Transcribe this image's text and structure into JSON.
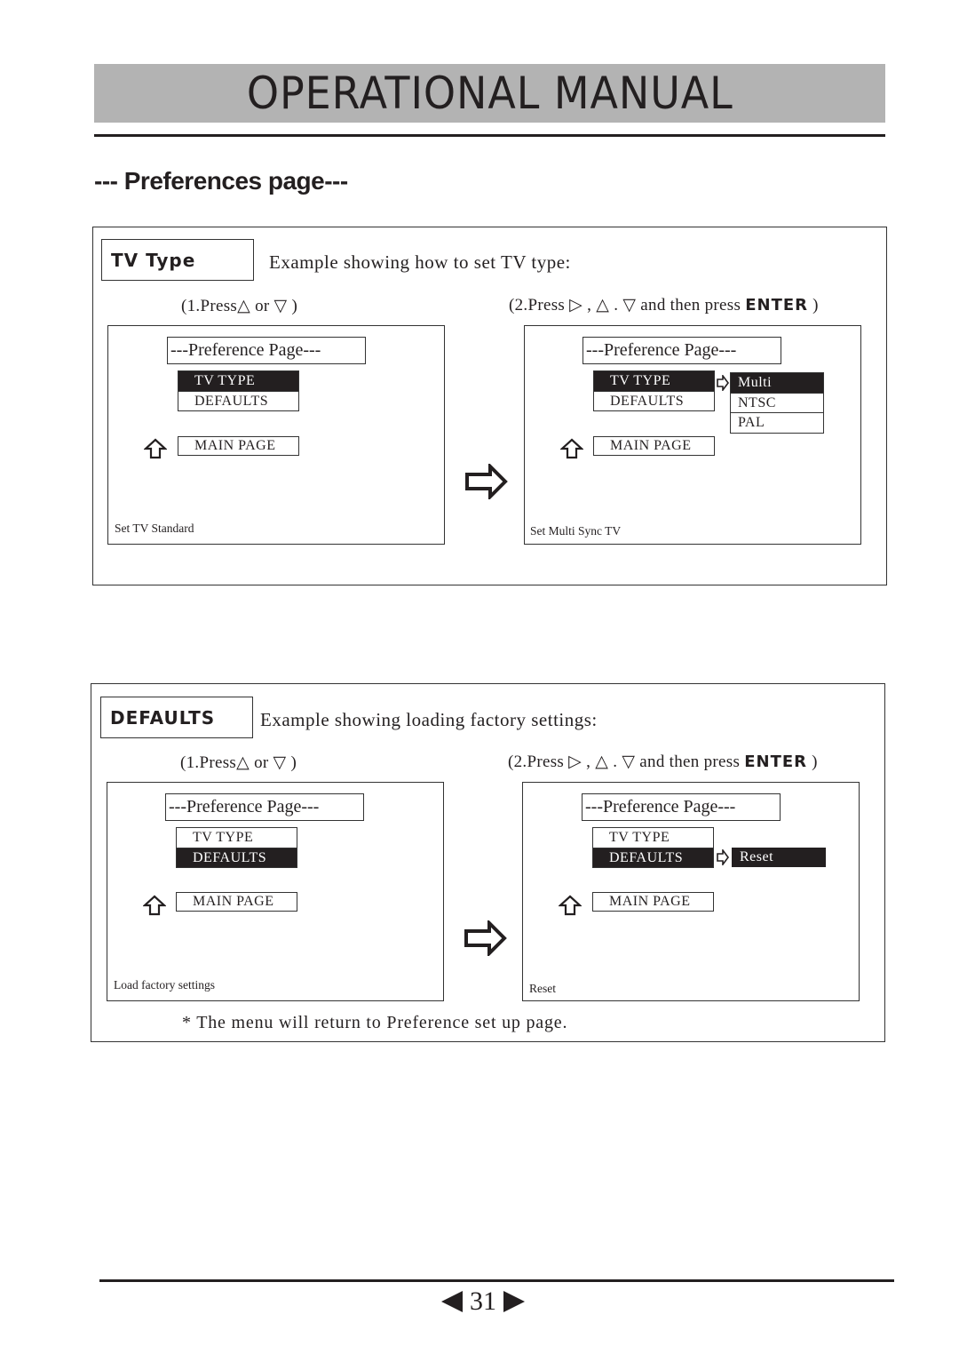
{
  "header": {
    "title": "OPERATIONAL MANUAL",
    "banner_color": "#b3b3b3"
  },
  "section_title": "--- Preferences page---",
  "icons": {
    "up_triangle": "△",
    "down_triangle": "▽",
    "right_triangle": "▷",
    "back_arrow": "up-outline-arrow",
    "transition_arrow": "right-outline-arrow",
    "page_prev": "◀",
    "page_next": "▶"
  },
  "panels": [
    {
      "tag": "TV Type",
      "description": "Example showing how to set TV type:",
      "step1": {
        "prefix": "(1.Press",
        "sym1": "△",
        "mid": " or ",
        "sym2": "▽",
        "suffix": " )"
      },
      "step2": {
        "prefix": "(2.Press ",
        "sym1": "▷",
        "sep1": " , ",
        "sym2": "△",
        "sep2": " . ",
        "sym3": "▽",
        "mid": " and then press ",
        "key": "ENTER",
        "suffix": " )"
      },
      "screens": [
        {
          "page_title": "---Preference Page---",
          "menu": [
            {
              "label": "TV TYPE",
              "selected": true
            },
            {
              "label": "DEFAULTS",
              "selected": false
            }
          ],
          "main_page": "MAIN PAGE",
          "status": "Set TV Standard"
        },
        {
          "page_title": "---Preference Page---",
          "menu": [
            {
              "label": "TV TYPE",
              "selected": true
            },
            {
              "label": "DEFAULTS",
              "selected": false
            }
          ],
          "submenu": [
            {
              "label": "Multi",
              "selected": true
            },
            {
              "label": "NTSC",
              "selected": false
            },
            {
              "label": "PAL",
              "selected": false
            }
          ],
          "main_page": "MAIN PAGE",
          "status": "Set Multi Sync TV"
        }
      ]
    },
    {
      "tag": "DEFAULTS",
      "description": "Example showing loading factory settings:",
      "step1": {
        "prefix": "(1.Press",
        "sym1": "△",
        "mid": " or ",
        "sym2": "▽",
        "suffix": " )"
      },
      "step2": {
        "prefix": "(2.Press ",
        "sym1": "▷",
        "sep1": " , ",
        "sym2": "△",
        "sep2": " . ",
        "sym3": "▽",
        "mid": " and then press ",
        "key": "ENTER",
        "suffix": " )"
      },
      "screens": [
        {
          "page_title": "---Preference Page---",
          "menu": [
            {
              "label": "TV TYPE",
              "selected": false
            },
            {
              "label": "DEFAULTS",
              "selected": true
            }
          ],
          "main_page": "MAIN PAGE",
          "status": "Load factory settings"
        },
        {
          "page_title": "---Preference Page---",
          "menu": [
            {
              "label": "TV TYPE",
              "selected": false
            },
            {
              "label": "DEFAULTS",
              "selected": true
            }
          ],
          "submenu": [
            {
              "label": "Reset",
              "selected": true
            }
          ],
          "main_page": "MAIN PAGE",
          "status": "Reset"
        }
      ],
      "footnote": "* The menu will return to Preference set up page."
    }
  ],
  "footer": {
    "page_number": "31"
  }
}
